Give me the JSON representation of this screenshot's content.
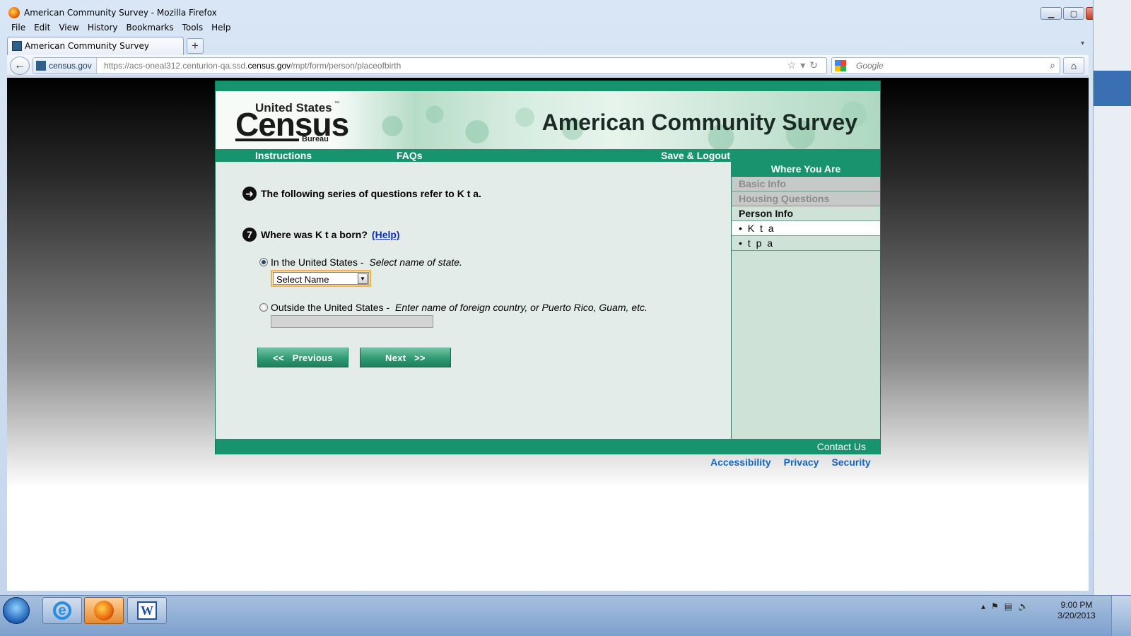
{
  "window": {
    "title": "American Community Survey - Mozilla Firefox"
  },
  "menubar": [
    "File",
    "Edit",
    "View",
    "History",
    "Bookmarks",
    "Tools",
    "Help"
  ],
  "tab": {
    "title": "American Community Survey",
    "new_tab": "+"
  },
  "urlbar": {
    "identity": "census.gov",
    "url_prefix": "https://acs-oneal312.centurion-qa.ssd.",
    "url_domain": "census.gov",
    "url_suffix": "/mpt/form/person/placeofbirth"
  },
  "searchbar": {
    "placeholder": "Google"
  },
  "header": {
    "logo_top": "United States",
    "logo_tm": "™",
    "logo_main": "Census",
    "logo_bottom": "Bureau",
    "site_title": "American Community Survey"
  },
  "nav": {
    "instructions": "Instructions",
    "faqs": "FAQs",
    "save_logout": "Save & Logout"
  },
  "main": {
    "intro": "The following series of questions refer to K t a.",
    "question_number": "7",
    "question": "Where was K t a born?",
    "help_link": "(Help)",
    "option_us_label": "In the United States - ",
    "option_us_hint": "Select name of state.",
    "state_select_value": "Select Name",
    "option_outside_label": "Outside the United States - ",
    "option_outside_hint": "Enter name of foreign country, or Puerto Rico, Guam, etc.",
    "country_value": "",
    "selected_option": "in_us",
    "previous_label": "<<   Previous",
    "next_label": "Next   >>"
  },
  "sidebar": {
    "heading": "Where You Are",
    "items": [
      {
        "label": "Basic Info",
        "state": "done"
      },
      {
        "label": "Housing Questions",
        "state": "done"
      },
      {
        "label": "Person Info",
        "state": "current"
      },
      {
        "label": "• K t a",
        "state": "active-person"
      },
      {
        "label": "• t p a",
        "state": "person"
      }
    ]
  },
  "footer": {
    "contact": "Contact Us",
    "links": [
      "Accessibility",
      "Privacy",
      "Security"
    ]
  },
  "taskbar": {
    "time": "9:00 PM",
    "date": "3/20/2013"
  },
  "colors": {
    "census_green": "#17946d",
    "link_blue": "#1566c0",
    "help_link": "#0b2fb8"
  }
}
